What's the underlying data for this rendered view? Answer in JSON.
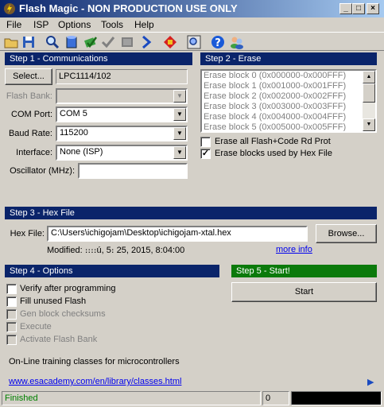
{
  "window": {
    "title": "Flash Magic - NON PRODUCTION USE ONLY",
    "minimize": "_",
    "maximize": "□",
    "close": "×"
  },
  "menu": [
    {
      "label": "File"
    },
    {
      "label": "ISP"
    },
    {
      "label": "Options"
    },
    {
      "label": "Tools"
    },
    {
      "label": "Help"
    }
  ],
  "toolbar": [
    "open-icon",
    "save-icon",
    "search-icon",
    "blank-check-icon",
    "erase-icon",
    "verify-icon",
    "program-icon",
    "run-icon",
    "red-devices-icon",
    "zoom-icon",
    "help-icon",
    "users-icon"
  ],
  "step1": {
    "title": "Step 1 - Communications",
    "select_button": "Select...",
    "device": "LPC1114/102",
    "flash_bank_label": "Flash Bank:",
    "flash_bank_value": "",
    "com_port_label": "COM Port:",
    "com_port_value": "COM 5",
    "baud_rate_label": "Baud Rate:",
    "baud_rate_value": "115200",
    "interface_label": "Interface:",
    "interface_value": "None (ISP)",
    "oscillator_label": "Oscillator (MHz):",
    "oscillator_value": ""
  },
  "step2": {
    "title": "Step 2 - Erase",
    "blocks": [
      "Erase block 0 (0x000000-0x000FFF)",
      "Erase block 1 (0x001000-0x001FFF)",
      "Erase block 2 (0x002000-0x002FFF)",
      "Erase block 3 (0x003000-0x003FFF)",
      "Erase block 4 (0x004000-0x004FFF)",
      "Erase block 5 (0x005000-0x005FFF)"
    ],
    "erase_all_label": "Erase all Flash+Code Rd Prot",
    "erase_all_checked": false,
    "erase_used_label": "Erase blocks used by Hex File",
    "erase_used_checked": true
  },
  "step3": {
    "title": "Step 3 - Hex File",
    "hex_file_label": "Hex File:",
    "hex_file_value": "C:\\Users\\ichigojam\\Desktop\\ichigojam-xtal.hex",
    "browse_button": "Browse...",
    "modified_text": "Modified: ։։։։ú, 5։ 25, 2015, 8:04:00",
    "more_info": "more info"
  },
  "step4": {
    "title": "Step 4 - Options",
    "options": [
      {
        "label": "Verify after programming",
        "checked": false,
        "enabled": true
      },
      {
        "label": "Fill unused Flash",
        "checked": false,
        "enabled": true
      },
      {
        "label": "Gen block checksums",
        "checked": false,
        "enabled": false
      },
      {
        "label": "Execute",
        "checked": false,
        "enabled": false
      },
      {
        "label": "Activate Flash Bank",
        "checked": false,
        "enabled": false
      }
    ]
  },
  "step5": {
    "title": "Step 5 - Start!",
    "start_button": "Start"
  },
  "info": {
    "text": "On-Line training classes for microcontrollers",
    "link": "www.esacademy.com/en/library/classes.html",
    "arrow": "▶"
  },
  "status": {
    "text": "Finished",
    "count": "0",
    "progress_fraction": 1.0
  },
  "colors": {
    "step_header": "#0a246a",
    "start_header": "#0b7a0b",
    "status_text": "#008000"
  }
}
